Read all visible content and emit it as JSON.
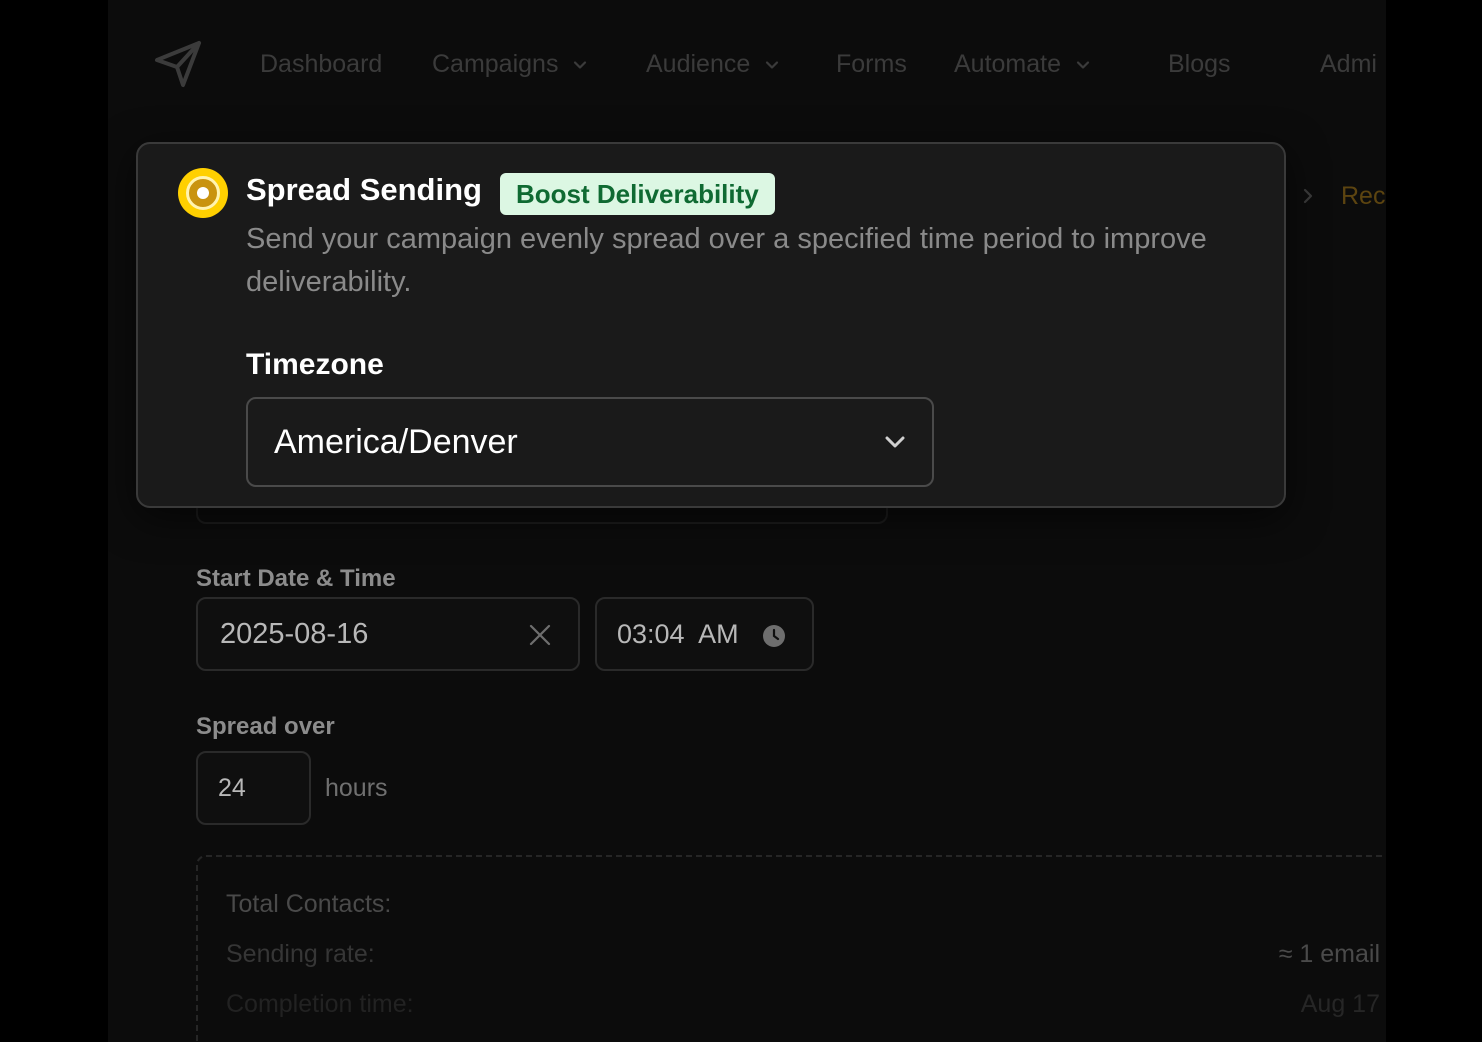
{
  "nav": {
    "items": [
      {
        "label": "Dashboard",
        "dropdown": false
      },
      {
        "label": "Campaigns",
        "dropdown": true
      },
      {
        "label": "Audience",
        "dropdown": true
      },
      {
        "label": "Forms",
        "dropdown": false
      },
      {
        "label": "Automate",
        "dropdown": true
      },
      {
        "label": "Blogs",
        "dropdown": false
      },
      {
        "label": "Admi",
        "dropdown": false
      }
    ]
  },
  "breadcrumb": {
    "label": "Rec"
  },
  "schedule": {
    "start_label": "Start Date & Time",
    "date_value": "2025-08-16",
    "time_value": "03:04  AM",
    "spread_label": "Spread over",
    "spread_value": "24",
    "spread_unit": "hours"
  },
  "summary": {
    "rows": [
      {
        "label": "Total Contacts:",
        "value": ""
      },
      {
        "label": "Sending rate:",
        "value": "≈ 1 email"
      },
      {
        "label": "Completion time:",
        "value": "Aug 17"
      }
    ]
  },
  "spread_option": {
    "title": "Spread Sending",
    "badge": "Boost Deliverability",
    "description": "Send your campaign evenly spread over a specified time period to improve deliverability.",
    "selected": true,
    "timezone_label": "Timezone",
    "timezone_value": "America/Denver"
  },
  "colors": {
    "accent_yellow": "#ffd000",
    "badge_bg": "#dcf7e3",
    "badge_text": "#0f6a32",
    "card_bg": "#1a1a1a"
  },
  "icons": [
    "paper-plane-icon",
    "chevron-down-icon",
    "chevron-right-icon",
    "close-icon",
    "clock-icon",
    "radio-selected-icon"
  ]
}
